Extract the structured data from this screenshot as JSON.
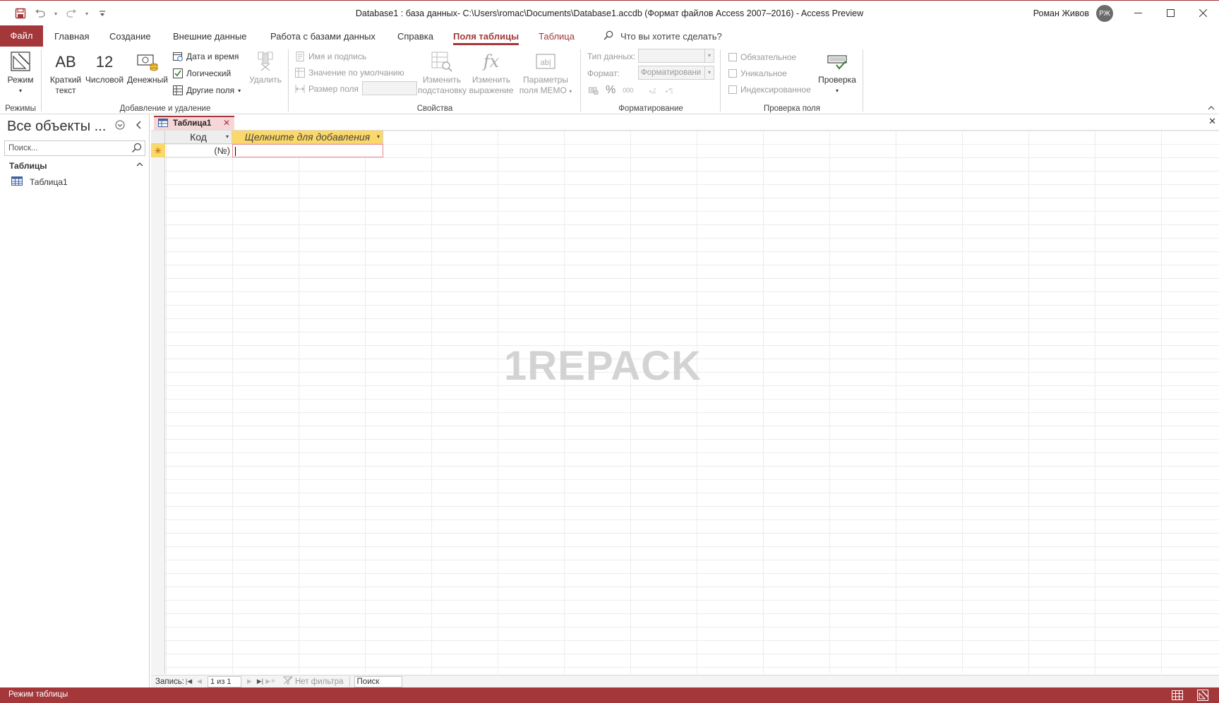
{
  "window": {
    "title": "Database1 : база данных- C:\\Users\\romac\\Documents\\Database1.accdb (Формат файлов Access 2007–2016)  -  Access Preview",
    "user_name": "Роман Живов",
    "user_initials": "РЖ"
  },
  "tabs": {
    "file": "Файл",
    "home": "Главная",
    "create": "Создание",
    "external": "Внешние данные",
    "dbtools": "Работа с базами данных",
    "help": "Справка",
    "table_fields": "Поля таблицы",
    "table": "Таблица",
    "tell_me": "Что вы хотите сделать?"
  },
  "ribbon": {
    "views": {
      "mode": "Режим",
      "label": "Режимы"
    },
    "add_delete": {
      "short_text_icon": "AB",
      "short_text_1": "Краткий",
      "short_text_2": "текст",
      "number_icon": "12",
      "number": "Числовой",
      "currency": "Денежный",
      "datetime": "Дата и время",
      "boolean": "Логический",
      "more_fields": "Другие поля",
      "delete": "Удалить",
      "label": "Добавление и удаление"
    },
    "properties": {
      "name_caption": "Имя и подпись",
      "default_value": "Значение по умолчанию",
      "field_size": "Размер поля",
      "modify_lookups_1": "Изменить",
      "modify_lookups_2": "подстановку",
      "modify_expression_1": "Изменить",
      "modify_expression_2": "выражение",
      "memo_settings_1": "Параметры",
      "memo_settings_2": "поля MEMO",
      "label": "Свойства"
    },
    "formatting": {
      "data_type": "Тип данных:",
      "format": "Формат:",
      "format_value": "Форматировани",
      "percent": "%",
      "thousands": "000",
      "label": "Форматирование"
    },
    "validation": {
      "required": "Обязательное",
      "unique": "Уникальное",
      "indexed": "Индексированное",
      "validation": "Проверка",
      "label": "Проверка поля"
    }
  },
  "nav": {
    "title": "Все объекты ...",
    "search_placeholder": "Поиск...",
    "section": "Таблицы",
    "items": [
      {
        "label": "Таблица1"
      }
    ]
  },
  "document": {
    "tab_label": "Таблица1",
    "columns": [
      {
        "label": "Код"
      },
      {
        "label": "Щелкните для добавления"
      }
    ],
    "new_row_marker": "✳",
    "new_row_id": "(№)"
  },
  "watermark": "1REPACK",
  "record_nav": {
    "label": "Запись:",
    "position": "1 из 1",
    "filter": "Нет фильтра",
    "search": "Поиск"
  },
  "status": {
    "text": "Режим таблицы"
  },
  "colors": {
    "accent": "#a4373a",
    "header_highlight": "#fbd86a"
  }
}
